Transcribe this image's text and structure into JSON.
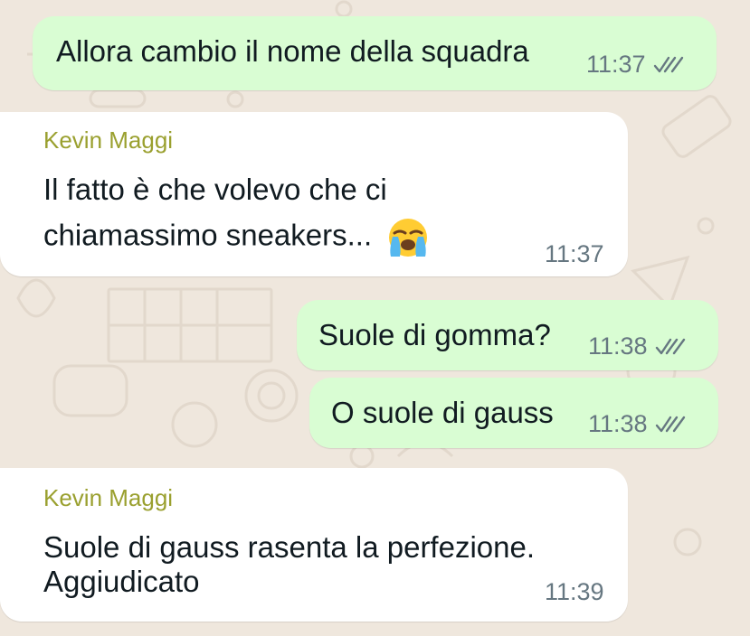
{
  "colors": {
    "background": "#efe7dd",
    "outgoing_bubble": "#d9fdd3",
    "incoming_bubble": "#ffffff",
    "sender_name": "#9aa02f",
    "timestamp": "#667781",
    "ticks": "#667781"
  },
  "messages": [
    {
      "direction": "outgoing",
      "text": "Allora cambio il nome della squadra",
      "time": "11:37",
      "status_icon": "double-check-icon"
    },
    {
      "direction": "incoming",
      "sender": "Kevin Maggi",
      "lines": [
        "Il fatto è che volevo che ci",
        "chiamassimo sneakers..."
      ],
      "emoji_icon": "loudly-crying-face-icon",
      "time": "11:37"
    },
    {
      "direction": "outgoing",
      "text": "Suole di gomma?",
      "time": "11:38",
      "status_icon": "double-check-icon"
    },
    {
      "direction": "outgoing",
      "text": "O suole di gauss",
      "time": "11:38",
      "status_icon": "double-check-icon"
    },
    {
      "direction": "incoming",
      "sender": "Kevin Maggi",
      "lines": [
        "Suole di gauss rasenta la perfezione.",
        "Aggiudicato"
      ],
      "time": "11:39"
    }
  ]
}
